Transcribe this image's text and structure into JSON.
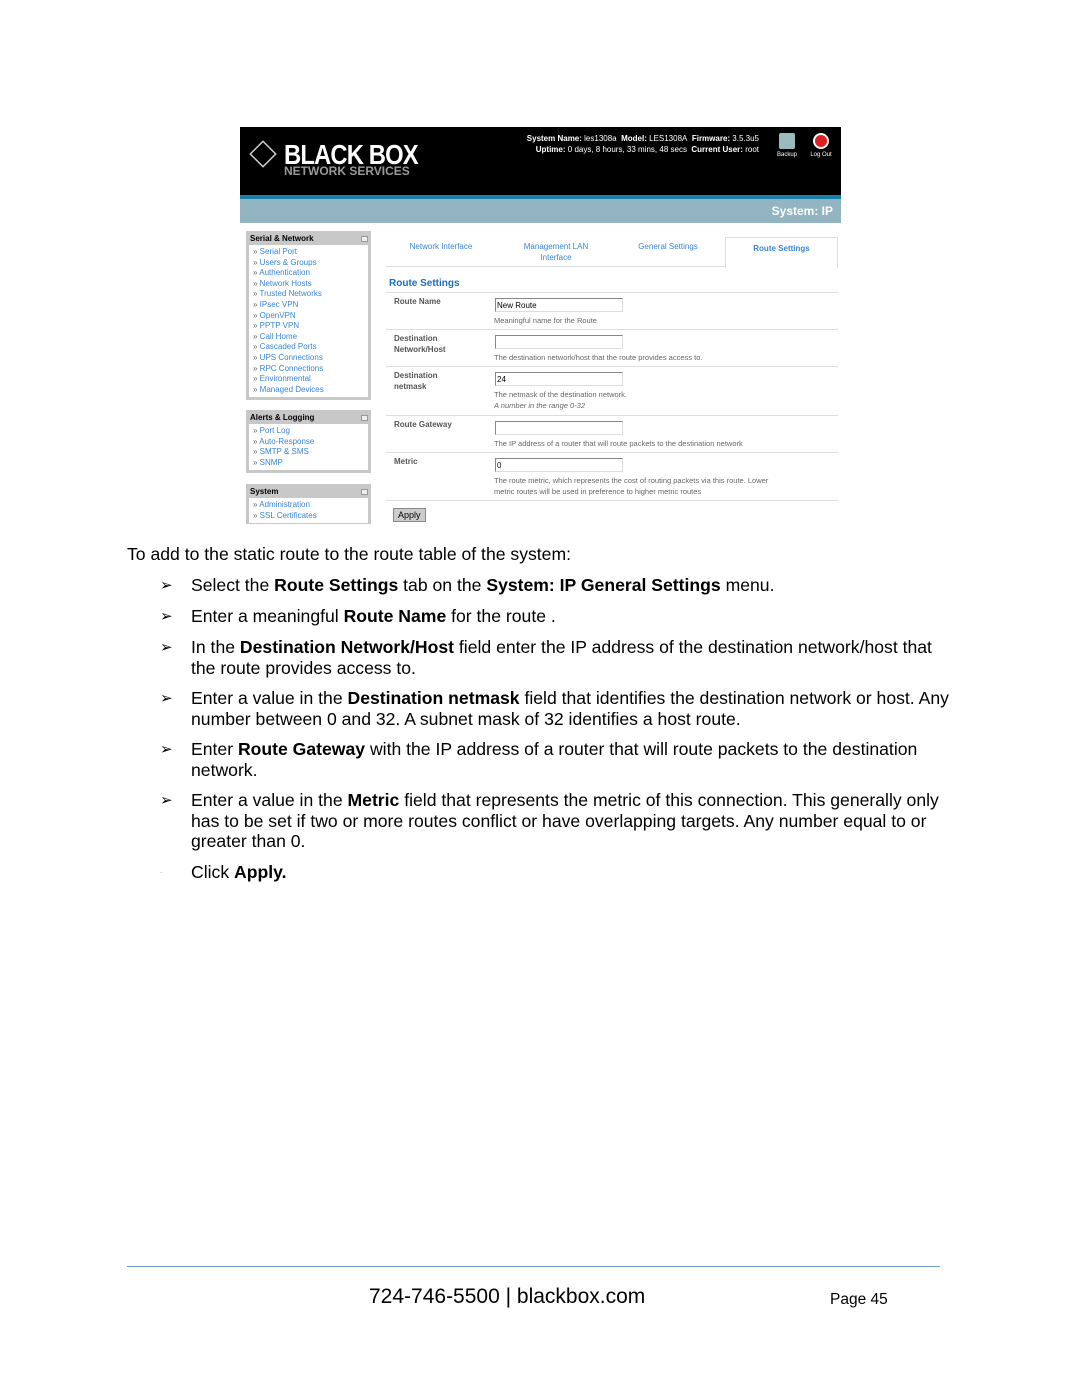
{
  "screenshot": {
    "logo": {
      "brand": "BLACK BOX",
      "sub": "NETWORK SERVICES"
    },
    "sysinfo": {
      "line1": [
        {
          "k": "System Name:",
          "v": "les1308a"
        },
        {
          "k": "Model:",
          "v": "LES1308A"
        },
        {
          "k": "Firmware:",
          "v": "3.5.3u5"
        }
      ],
      "line2": [
        {
          "k": "Uptime:",
          "v": "0 days, 8 hours, 33 mins, 48 secs"
        },
        {
          "k": "Current User:",
          "v": "root"
        }
      ]
    },
    "backup_label": "Backup",
    "logout_label": "Log Out",
    "page_heading": "System: IP",
    "sidebar": [
      {
        "title": "Serial & Network",
        "items": [
          "Serial Port",
          "Users & Groups",
          "Authentication",
          "Network Hosts",
          "Trusted Networks",
          "IPsec VPN",
          "OpenVPN",
          "PPTP VPN",
          "Call Home",
          "Cascaded Ports",
          "UPS Connections",
          "RPC Connections",
          "Environmental",
          "Managed Devices"
        ]
      },
      {
        "title": "Alerts & Logging",
        "items": [
          "Port Log",
          "Auto-Response",
          "SMTP & SMS",
          "SNMP"
        ]
      },
      {
        "title": "System",
        "items": [
          "Administration",
          "SSL Certificates"
        ]
      }
    ],
    "tabs": [
      {
        "label": "Network Interface"
      },
      {
        "label": "Management LAN Interface"
      },
      {
        "label": "General Settings"
      },
      {
        "label": "Route Settings",
        "active": true
      }
    ],
    "section_title": "Route Settings",
    "fields": [
      {
        "label": "Route Name",
        "value": "New Route",
        "desc": "Meaningful name for the Route"
      },
      {
        "label": "Destination Network/Host",
        "value": "",
        "desc": "The destination network/host that the route provides access to."
      },
      {
        "label": "Destination netmask",
        "value": "24",
        "desc": "The netmask of the destination network.",
        "hint": "A number in the range 0-32"
      },
      {
        "label": "Route Gateway",
        "value": "",
        "desc": "The IP address of a router that will route packets to the destination network"
      },
      {
        "label": "Metric",
        "value": "0",
        "desc": "The route metric, which represents the cost of routing packets via this route. Lower",
        "desc2": "metric routes will be used in preference to higher metric routes"
      }
    ],
    "apply_label": "Apply"
  },
  "doc": {
    "intro": "To add to the static route to the route table of the system:",
    "steps": [
      [
        "Select the ",
        "Route Settings",
        " tab on the ",
        "System: IP General Settings",
        " menu."
      ],
      [
        "Enter a meaningful ",
        "Route Name",
        " for the route ."
      ],
      [
        "In the ",
        "Destination Network/Host",
        " field enter the IP address of the destination network/host that",
        "the route provides access to."
      ],
      [
        "Enter a value in the ",
        "Destination netmask",
        " field that identifies the destination network or host. Any",
        "number between 0 and 32. A subnet mask of 32 identifies a host route."
      ],
      [
        "Enter ",
        "Route Gateway",
        " with the IP address of a router that will route packets to the destination",
        "network."
      ],
      [
        "Enter a value in the ",
        "Metric",
        " field that represents the metric of this connection. This generally only",
        "has to be set if two or more routes conflict or have overlapping targets. Any number equal to or",
        "greater than 0."
      ]
    ],
    "last_step": {
      "pre": "Click ",
      "bold": "Apply."
    },
    "bullet": "➢"
  },
  "footer": {
    "contact": "724-746-5500 | blackbox.com",
    "page": "Page 45"
  }
}
